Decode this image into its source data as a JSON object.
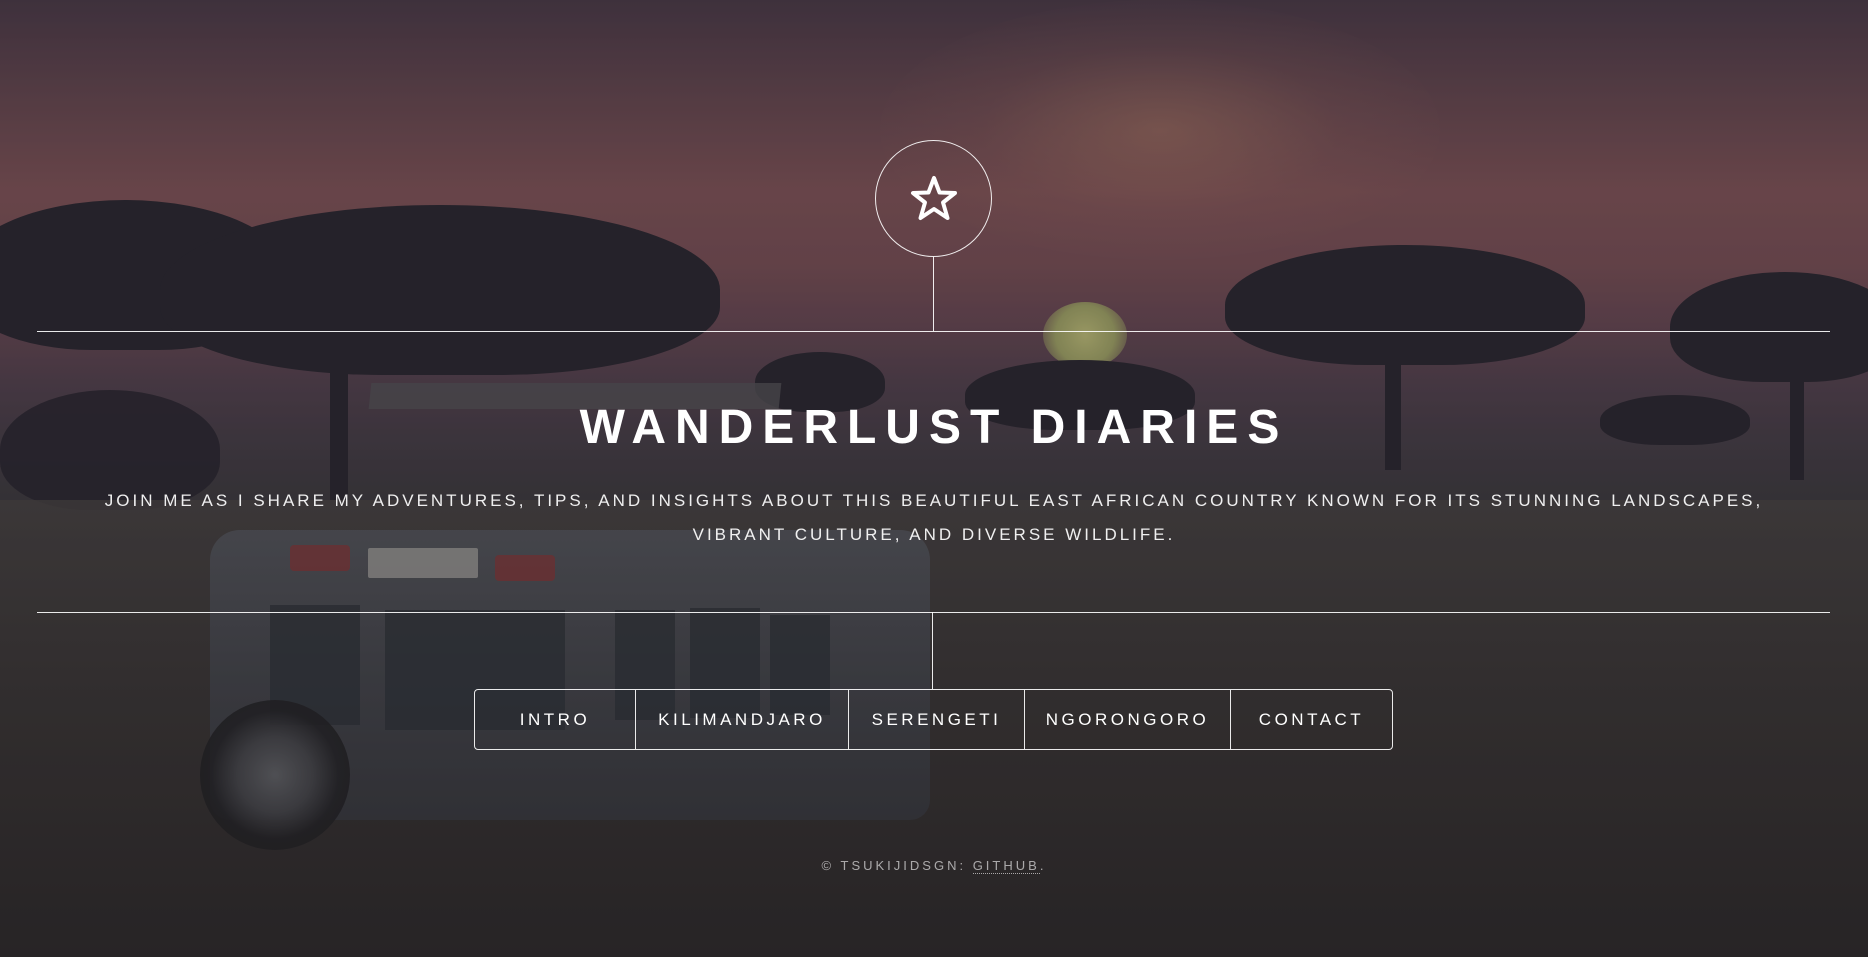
{
  "header": {
    "logo_icon": "star-icon",
    "title": "WANDERLUST DIARIES",
    "tagline": "Join me as I share my adventures, tips, and insights about this beautiful East African country known for its stunning landscapes, vibrant culture, and diverse wildlife."
  },
  "nav": {
    "items": [
      {
        "label": "INTRO"
      },
      {
        "label": "KILIMANDJARO"
      },
      {
        "label": "SERENGETI"
      },
      {
        "label": "NGORONGORO"
      },
      {
        "label": "CONTACT"
      }
    ]
  },
  "footer": {
    "copyright": "© TSUKIJIDSGN: ",
    "link_label": "GITHUB",
    "suffix": "."
  }
}
